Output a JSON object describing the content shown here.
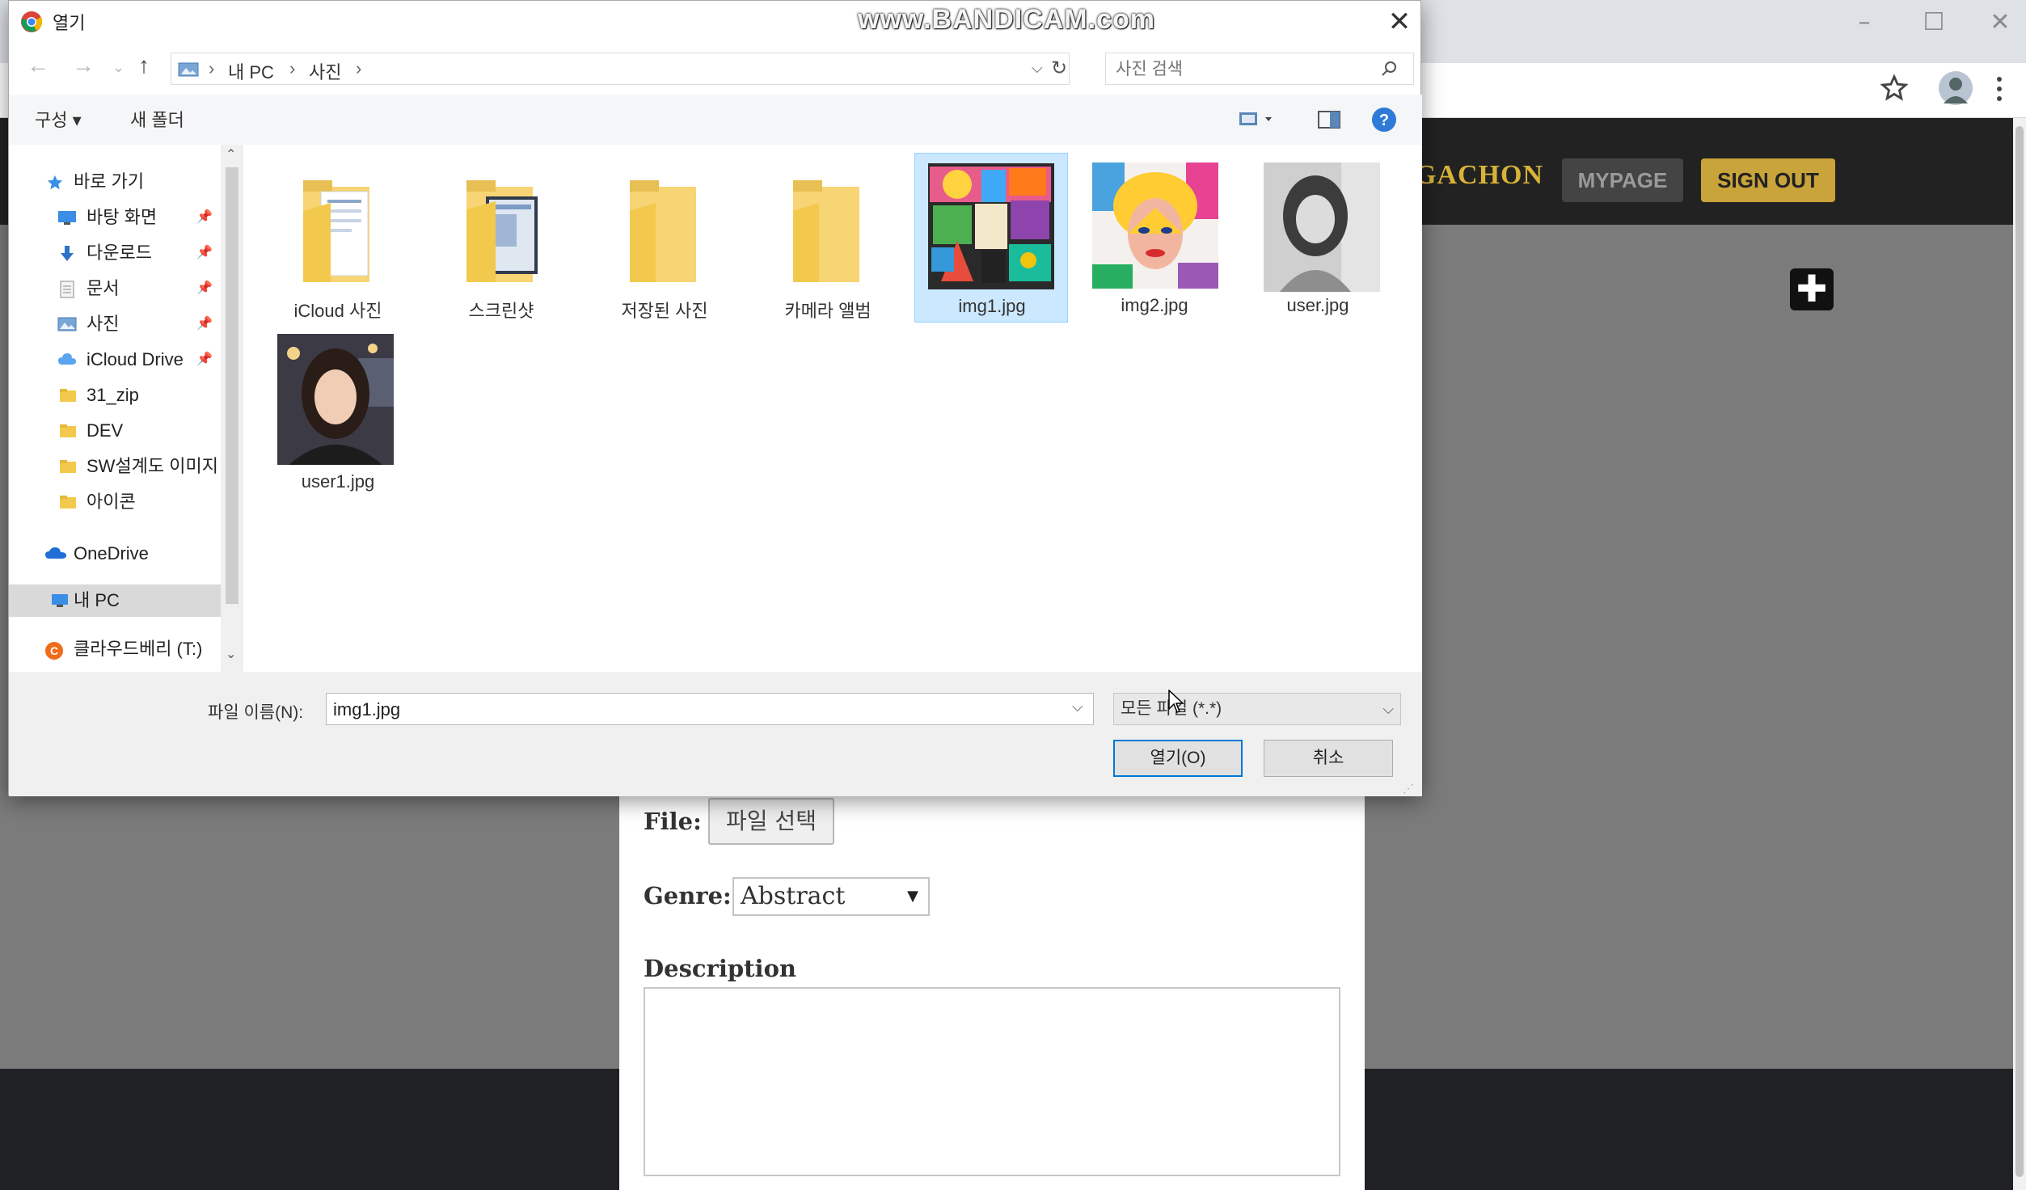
{
  "browser": {
    "window_controls": {
      "minimize": "–",
      "maximize": "☐",
      "close": "✕"
    }
  },
  "site": {
    "brand": "GACHON",
    "mypage_label": "MYPAGE",
    "signout_label": "SIGN OUT",
    "add_label": "✚",
    "colors": {
      "nav": "#222222",
      "brand": "#d8b338",
      "signout": "#c9a43a",
      "backdrop": "#7b7b7b"
    }
  },
  "upload_form": {
    "file_label": "File:",
    "choose_button": "파일 선택",
    "genre_label": "Genre:",
    "genre_selected": "Abstract",
    "description_label": "Description",
    "description_value": ""
  },
  "dialog": {
    "title": "열기",
    "watermark": "www.BANDICAM.com",
    "breadcrumb": [
      "내 PC",
      "사진"
    ],
    "search_placeholder": "사진 검색",
    "toolbar": {
      "organize": "구성 ▾",
      "new_folder": "새 폴더"
    },
    "nav": [
      {
        "label": "바로 가기",
        "icon": "star-icon",
        "pinned": false,
        "indent": 1
      },
      {
        "label": "바탕 화면",
        "icon": "desktop-icon",
        "pinned": true,
        "indent": 2
      },
      {
        "label": "다운로드",
        "icon": "download-icon",
        "pinned": true,
        "indent": 2
      },
      {
        "label": "문서",
        "icon": "document-icon",
        "pinned": true,
        "indent": 2
      },
      {
        "label": "사진",
        "icon": "pictures-icon",
        "pinned": true,
        "indent": 2
      },
      {
        "label": "iCloud Drive",
        "icon": "cloud-icon",
        "pinned": true,
        "indent": 2
      },
      {
        "label": "31_zip",
        "icon": "folder-icon",
        "pinned": false,
        "indent": 2
      },
      {
        "label": "DEV",
        "icon": "folder-icon",
        "pinned": false,
        "indent": 2
      },
      {
        "label": "SW설계도 이미지",
        "icon": "folder-icon",
        "pinned": false,
        "indent": 2
      },
      {
        "label": "아이콘",
        "icon": "folder-icon",
        "pinned": false,
        "indent": 2
      },
      {
        "label": "OneDrive",
        "icon": "onedrive-icon",
        "pinned": false,
        "indent": 1
      },
      {
        "label": "내 PC",
        "icon": "pc-icon",
        "pinned": false,
        "indent": 1,
        "selected": true
      },
      {
        "label": "클라우드베리 (T:)",
        "icon": "drive-icon",
        "pinned": false,
        "indent": 1
      }
    ],
    "files": [
      {
        "name": "iCloud 사진",
        "type": "folder"
      },
      {
        "name": "스크린샷",
        "type": "folder-docs"
      },
      {
        "name": "저장된 사진",
        "type": "folder"
      },
      {
        "name": "카메라 앨범",
        "type": "folder"
      },
      {
        "name": "img1.jpg",
        "type": "image",
        "selected": true
      },
      {
        "name": "img2.jpg",
        "type": "image"
      },
      {
        "name": "user.jpg",
        "type": "image"
      },
      {
        "name": "user1.jpg",
        "type": "image"
      }
    ],
    "filename_label": "파일 이름(N):",
    "filename_value": "img1.jpg",
    "filetype_value": "모든 파일 (*.*)",
    "open_label": "열기(O)",
    "cancel_label": "취소",
    "accent_color": "#0078d7"
  }
}
